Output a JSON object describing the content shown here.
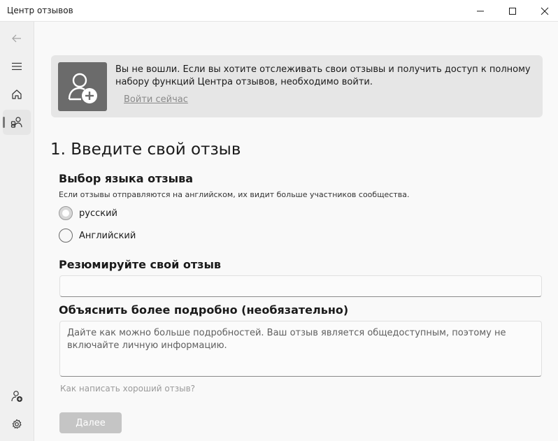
{
  "window": {
    "title": "Центр отзывов"
  },
  "sidebar": {
    "items": [
      {
        "name": "back",
        "icon": "back-arrow-icon"
      },
      {
        "name": "menu",
        "icon": "hamburger-icon"
      },
      {
        "name": "home",
        "icon": "home-icon"
      },
      {
        "name": "feedback",
        "icon": "feedback-icon",
        "active": true
      },
      {
        "name": "add-account",
        "icon": "person-add-icon"
      },
      {
        "name": "settings",
        "icon": "gear-icon"
      }
    ]
  },
  "banner": {
    "message": "Вы не вошли. Если вы хотите отслеживать свои отзывы и получить доступ к полному набору функций Центра отзывов, необходимо войти.",
    "signin_link": "Войти сейчас"
  },
  "form": {
    "step_title": "1. Введите свой отзыв",
    "language_title": "Выбор языка отзыва",
    "language_hint": "Если отзывы отправляются на английском, их видит больше участников сообщества.",
    "options": [
      {
        "label": "русский",
        "selected": true
      },
      {
        "label": "Английский",
        "selected": false
      }
    ],
    "summary_title": "Резюмируйте свой отзыв",
    "summary_value": "",
    "details_title": "Объяснить более подробно (необязательно)",
    "details_placeholder": "Дайте как можно больше подробностей. Ваш отзыв является общедоступным, поэтому не включайте личную информацию.",
    "help_link": "Как написать хороший отзыв?",
    "next_button": "Далее"
  },
  "colors": {
    "banner_bg": "#e6e6e6",
    "icon_tile": "#6b6b6b",
    "disabled_button": "#c5c5c5"
  }
}
